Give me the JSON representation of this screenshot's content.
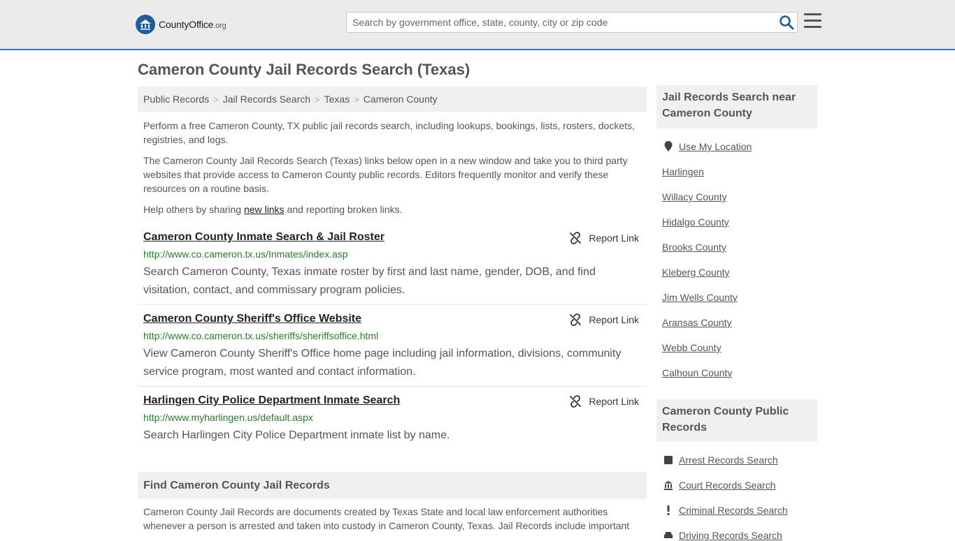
{
  "header": {
    "logo_brand": "CountyOffice",
    "logo_tld": ".org",
    "search_placeholder": "Search by government office, state, county, city or zip code"
  },
  "page": {
    "title": "Cameron County Jail Records Search (Texas)"
  },
  "breadcrumb": [
    "Public Records",
    "Jail Records Search",
    "Texas",
    "Cameron County"
  ],
  "intro": {
    "p1": "Perform a free Cameron County, TX public jail records search, including lookups, bookings, lists, rosters, dockets, registries, and logs.",
    "p2": "The Cameron County Jail Records Search (Texas) links below open in a new window and take you to third party websites that provide access to Cameron County public records. Editors frequently monitor and verify these resources on a routine basis.",
    "p3_before": "Help others by sharing ",
    "p3_link": "new links",
    "p3_after": " and reporting broken links."
  },
  "report_label": "Report Link",
  "results": [
    {
      "title": "Cameron County Inmate Search & Jail Roster",
      "url": "http://www.co.cameron.tx.us/Inmates/index.asp",
      "desc": "Search Cameron County, Texas inmate roster by first and last name, gender, DOB, and find visitation, contact, and commissary program policies."
    },
    {
      "title": "Cameron County Sheriff's Office Website",
      "url": "http://www.co.cameron.tx.us/sheriffs/sheriffsoffice.html",
      "desc": "View Cameron County Sheriff's Office home page including jail information, divisions, community service program, most wanted and contact information."
    },
    {
      "title": "Harlingen City Police Department Inmate Search",
      "url": "http://www.myharlingen.us/default.aspx",
      "desc": "Search Harlingen City Police Department inmate list by name."
    }
  ],
  "find_section": {
    "heading": "Find Cameron County Jail Records",
    "text": "Cameron County Jail Records are documents created by Texas State and local law enforcement authorities whenever a person is arrested and taken into custody in Cameron County, Texas. Jail Records include important"
  },
  "sidebar": {
    "nearby_heading": "Jail Records Search near Cameron County",
    "use_location": "Use My Location",
    "nearby_links": [
      "Harlingen",
      "Willacy County",
      "Hidalgo County",
      "Brooks County",
      "Kleberg County",
      "Jim Wells County",
      "Aransas County",
      "Webb County",
      "Calhoun County"
    ],
    "public_heading": "Cameron County Public Records",
    "public_links": [
      {
        "label": "Arrest Records Search",
        "icon": "square-icon"
      },
      {
        "label": "Court Records Search",
        "icon": "courthouse-icon"
      },
      {
        "label": "Criminal Records Search",
        "icon": "exclamation-icon"
      },
      {
        "label": "Driving Records Search",
        "icon": "car-icon"
      }
    ]
  },
  "colors": {
    "accent": "#2e74b5",
    "logo_blue": "#1d5e9c",
    "url_green": "#2b7a2b",
    "panel_bg": "#f0f0f0",
    "header_bg": "#ebebeb"
  }
}
